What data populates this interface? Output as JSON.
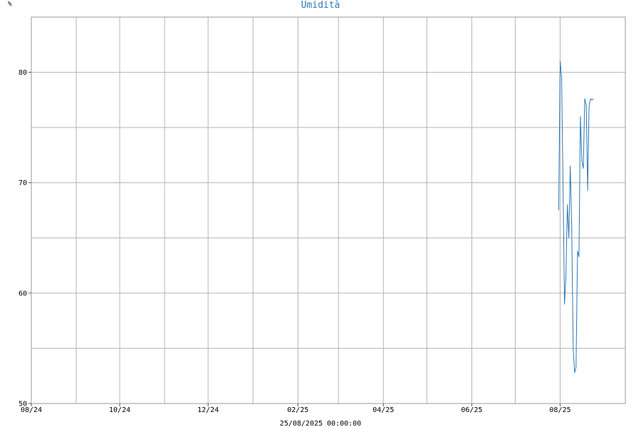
{
  "chart_data": {
    "type": "line",
    "title": "Umidità",
    "ylabel": "%",
    "xlabel": "",
    "footer": "25/08/2025 00:00:00",
    "ylim": [
      50,
      85
    ],
    "yticks": [
      50,
      60,
      70,
      80
    ],
    "xlim": [
      "2024-08-01",
      "2025-09-15"
    ],
    "xticks": [
      {
        "date": "2024-08-01",
        "label": "08/24"
      },
      {
        "date": "2024-10-01",
        "label": "10/24"
      },
      {
        "date": "2024-12-01",
        "label": "12/24"
      },
      {
        "date": "2025-02-01",
        "label": "02/25"
      },
      {
        "date": "2025-04-01",
        "label": "04/25"
      },
      {
        "date": "2025-06-01",
        "label": "06/25"
      },
      {
        "date": "2025-08-01",
        "label": "08/25"
      }
    ],
    "x_minor_gridlines": [
      "2024-09-01",
      "2024-11-01",
      "2025-01-01",
      "2025-03-01",
      "2025-05-01",
      "2025-07-01"
    ],
    "y_minor_gridlines": [
      55,
      65,
      75
    ],
    "grid": true,
    "series_color": "#2e78b5",
    "series": [
      {
        "x": [
          "2025-07-31",
          "2025-08-01",
          "2025-08-02",
          "2025-08-03",
          "2025-08-04",
          "2025-08-05",
          "2025-08-06",
          "2025-08-07",
          "2025-08-08",
          "2025-08-09",
          "2025-08-10",
          "2025-08-11",
          "2025-08-12",
          "2025-08-13",
          "2025-08-14",
          "2025-08-15",
          "2025-08-16",
          "2025-08-17",
          "2025-08-18",
          "2025-08-19",
          "2025-08-20",
          "2025-08-21",
          "2025-08-22",
          "2025-08-23",
          "2025-08-24"
        ],
        "values": [
          67.5,
          81.0,
          79.5,
          70.0,
          59.0,
          61.5,
          68.0,
          65.0,
          71.5,
          66.0,
          55.0,
          52.8,
          53.3,
          63.8,
          63.3,
          76.0,
          72.0,
          71.3,
          77.6,
          77.0,
          69.3,
          77.0,
          77.6,
          77.5,
          77.6
        ]
      }
    ]
  }
}
